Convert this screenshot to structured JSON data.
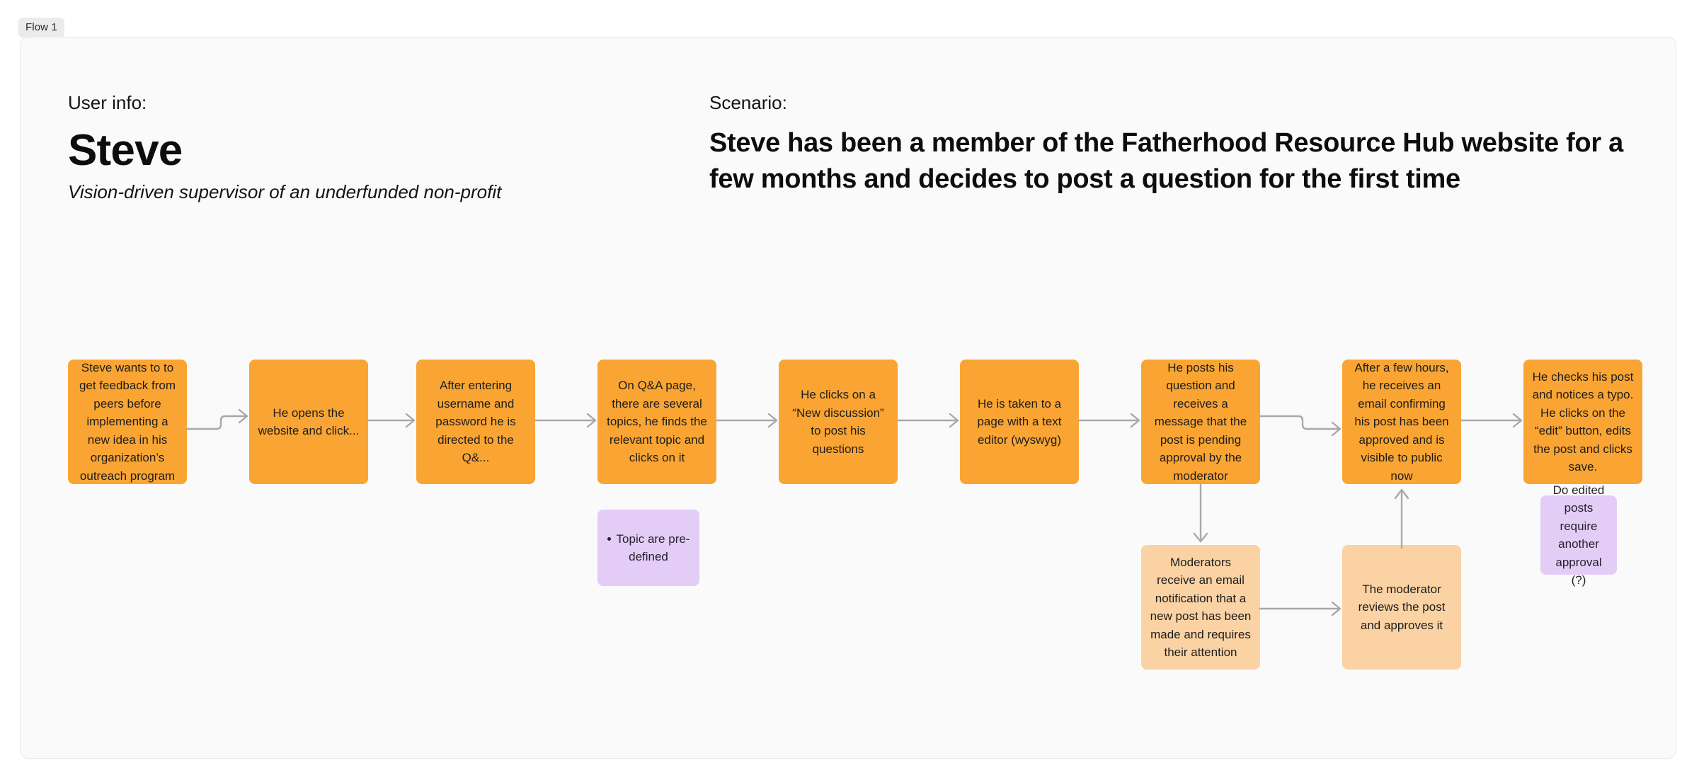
{
  "frame": {
    "label": "Flow 1"
  },
  "header": {
    "user_info": {
      "eyebrow": "User info:",
      "name": "Steve",
      "subtitle": "Vision-driven supervisor of an underfunded non-profit"
    },
    "scenario": {
      "eyebrow": "Scenario:",
      "body": "Steve has been a member of the Fatherhood Resource Hub website for a few months and decides to post a question for the first time"
    }
  },
  "colors": {
    "step_orange": "#FAA533",
    "moderator_peach": "#FBD2A3",
    "note_purple": "#E3CDF7",
    "connector_gray": "#A8A8A8",
    "frame_background": "#FAFAFA",
    "frame_border": "#E8E8E8",
    "badge_background": "#EBEBEB"
  },
  "flow": {
    "main_steps": [
      {
        "id": "step-1",
        "text": "Steve wants to to get feedback from peers before implementing a new idea in his organization’s outreach program"
      },
      {
        "id": "step-2",
        "text": "He opens the website and click..."
      },
      {
        "id": "step-3",
        "text": "After entering username and password he is directed to the Q&..."
      },
      {
        "id": "step-4",
        "text": "On Q&A page, there are several topics, he finds the relevant topic and clicks on it"
      },
      {
        "id": "step-5",
        "text": "He clicks on a “New discussion” to post his questions"
      },
      {
        "id": "step-6",
        "text": "He is taken to a page with a text editor (wyswyg)"
      },
      {
        "id": "step-7",
        "text": "He posts his question and receives a message that the post is pending approval by the moderator"
      },
      {
        "id": "step-8",
        "text": "After a few hours, he receives an email confirming his post has been approved and is visible to public now"
      },
      {
        "id": "step-9",
        "text": "He checks his post and notices a typo. He clicks on the “edit” button, edits the post and clicks save."
      }
    ],
    "moderator_steps": [
      {
        "id": "mod-1",
        "text": "Moderators receive an email notification that a new post has been made and requires their attention"
      },
      {
        "id": "mod-2",
        "text": "The moderator reviews the post and approves it"
      }
    ],
    "notes": [
      {
        "id": "note-1",
        "text": "Topic are pre-defined",
        "bulleted": true
      },
      {
        "id": "note-2",
        "text": "Do edited posts require another approval (?)",
        "bulleted": false
      }
    ]
  }
}
